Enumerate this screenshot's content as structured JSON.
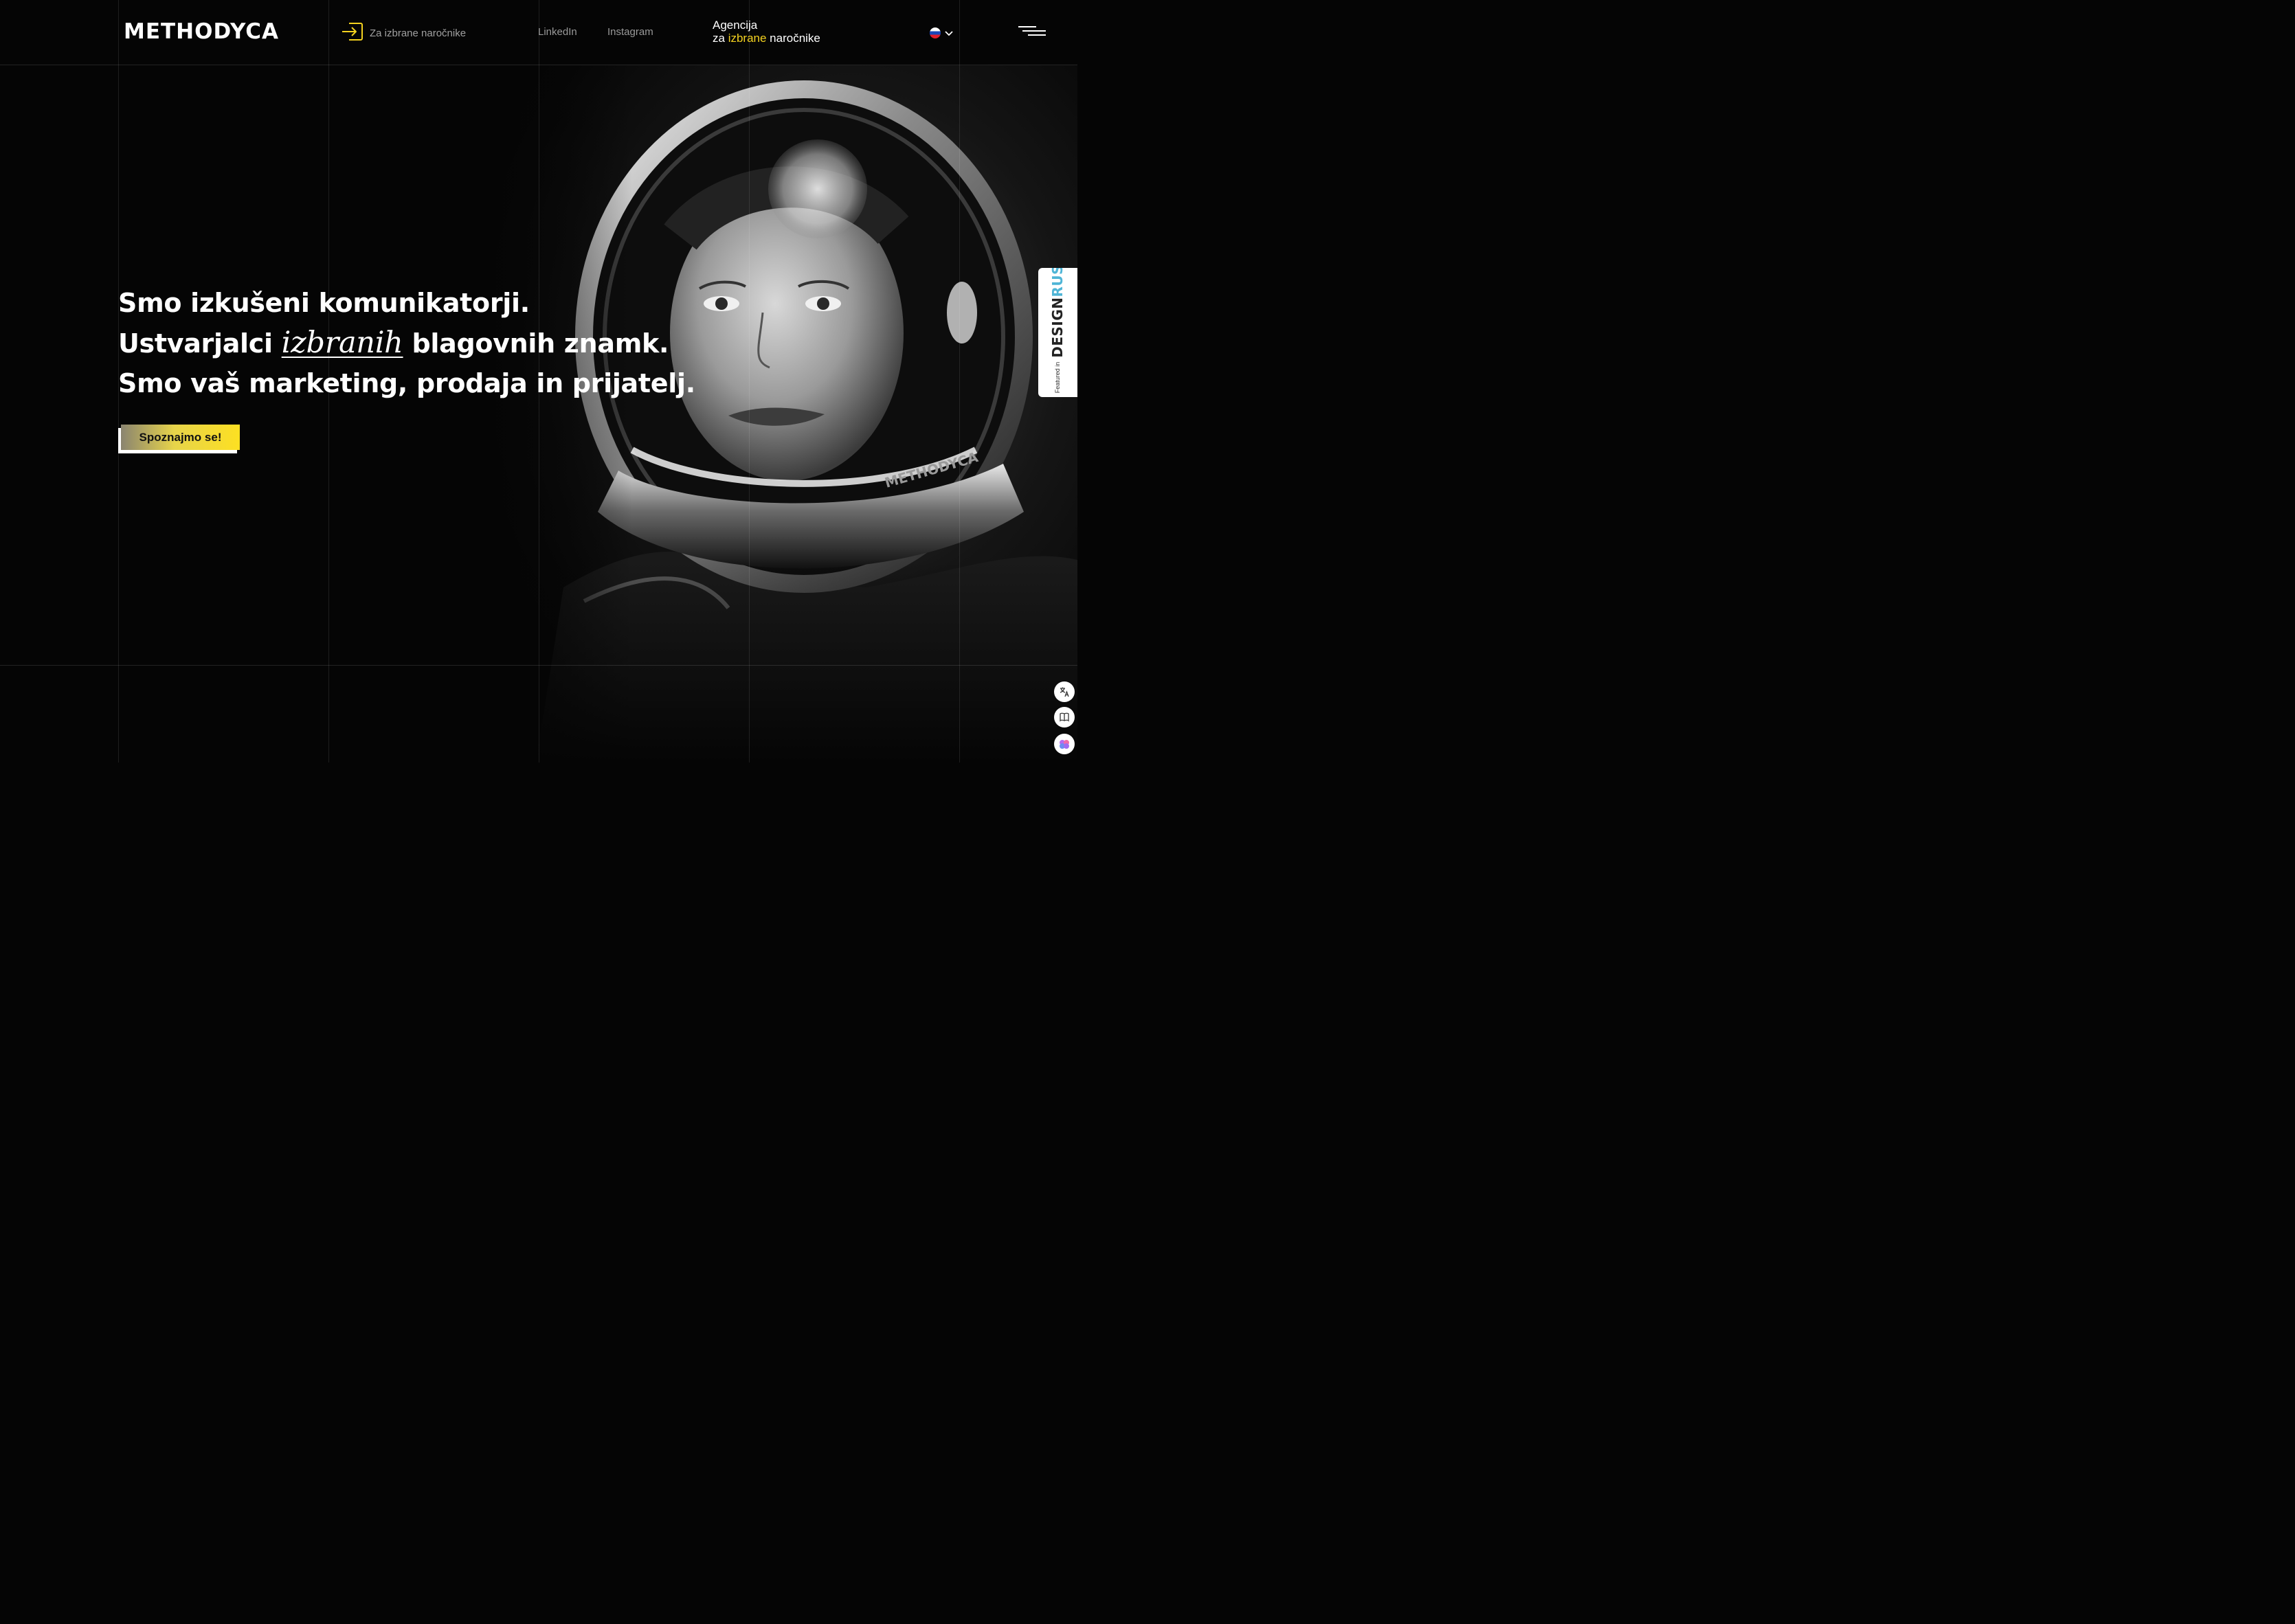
{
  "header": {
    "logo": "METHODYCA",
    "login_label": "Za izbrane naročnike",
    "nav": {
      "linkedin": "LinkedIn",
      "instagram": "Instagram"
    },
    "tagline": {
      "line1": "Agencija",
      "prefix": "za ",
      "accent": "izbrane",
      "suffix": " naročnike"
    },
    "language": "sl"
  },
  "hero": {
    "line1": "Smo izkušeni komunikatorji.",
    "line2_before": "Ustvarjalci ",
    "line2_italic": "izbranih",
    "line2_after": " blagovnih znamk.",
    "line3": "Smo vaš marketing, prodaja in prijatelj.",
    "cta_label": "Spoznajmo se!"
  },
  "badge": {
    "small": "Featured in",
    "design": "DESIGN",
    "rush": "RUSH"
  },
  "floating_tools": [
    "translate-icon",
    "book-icon",
    "brain-icon"
  ],
  "colors": {
    "background": "#050505",
    "accent_yellow": "#f4d21f",
    "badge_rush": "#4fb5d6"
  }
}
